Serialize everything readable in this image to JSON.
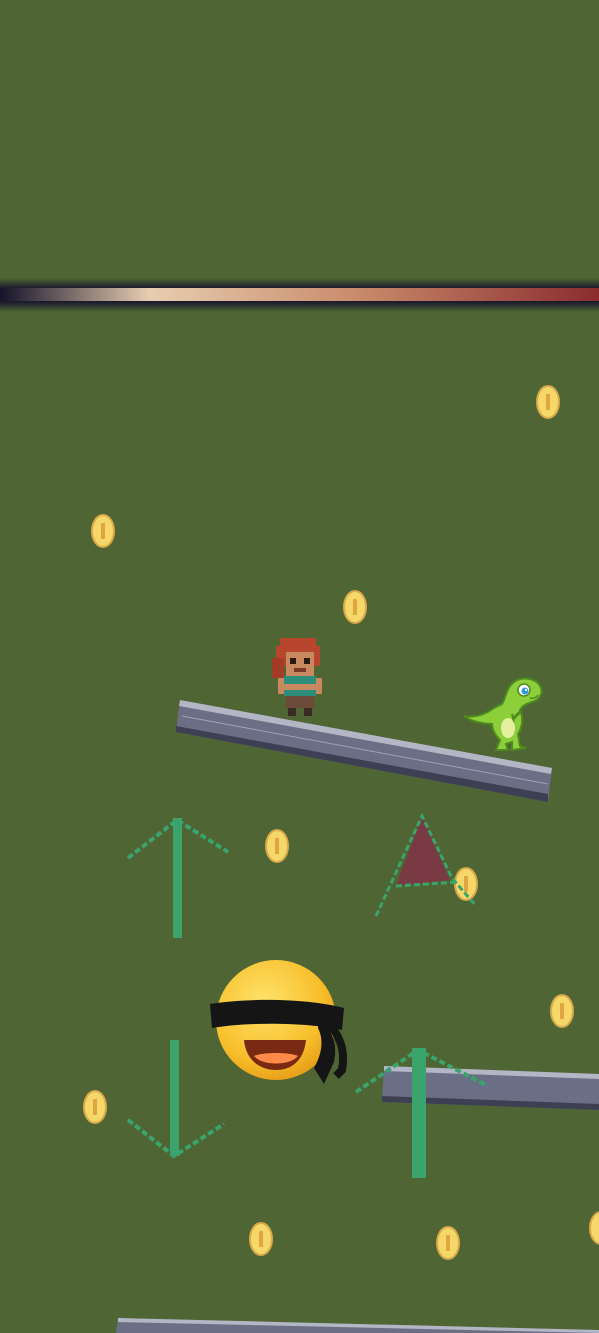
{
  "game": {
    "background_color": "#4f6533",
    "laser_colors": [
      "#1b1a2c",
      "#e6c8a6",
      "#8b2f2f"
    ],
    "platform_color": "#6b6f86",
    "arrow_color": "#3aa46c",
    "spike_color": "#7a3a44",
    "coin_color": "#f6d86a"
  },
  "sprites": {
    "player": "pixel-girl-character",
    "enemy": "green-dinosaur",
    "blindfold_emoji": "blindfolded-smiley-emoji"
  },
  "arrows": [
    {
      "name": "up-arrow-left",
      "direction": "up"
    },
    {
      "name": "down-arrow-left",
      "direction": "down"
    },
    {
      "name": "up-arrow-right",
      "direction": "up"
    }
  ]
}
